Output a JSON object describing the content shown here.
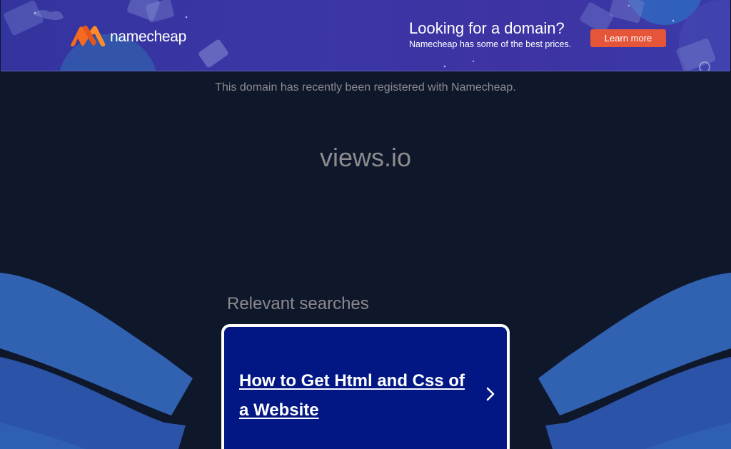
{
  "banner": {
    "logo_text": "namecheap",
    "promo_title": "Looking for a domain?",
    "promo_subtitle": "Namecheap has some of the best prices.",
    "learn_more_label": "Learn more",
    "colors": {
      "background": "#3a36a5",
      "button": "#e5553a",
      "logo_orange": "#f46a21"
    }
  },
  "main": {
    "registration_notice": "This domain has recently been registered with Namecheap.",
    "domain": "views.io"
  },
  "relevant": {
    "title": "Relevant searches",
    "items": [
      {
        "label": "How to Get Html and Css of a Website",
        "icon": "chevron-right-icon"
      }
    ]
  },
  "colors": {
    "page_background": "#0f172b",
    "card_background": "#021783",
    "wave_light": "#2d59aa",
    "wave_dark": "#2a4fa0"
  }
}
